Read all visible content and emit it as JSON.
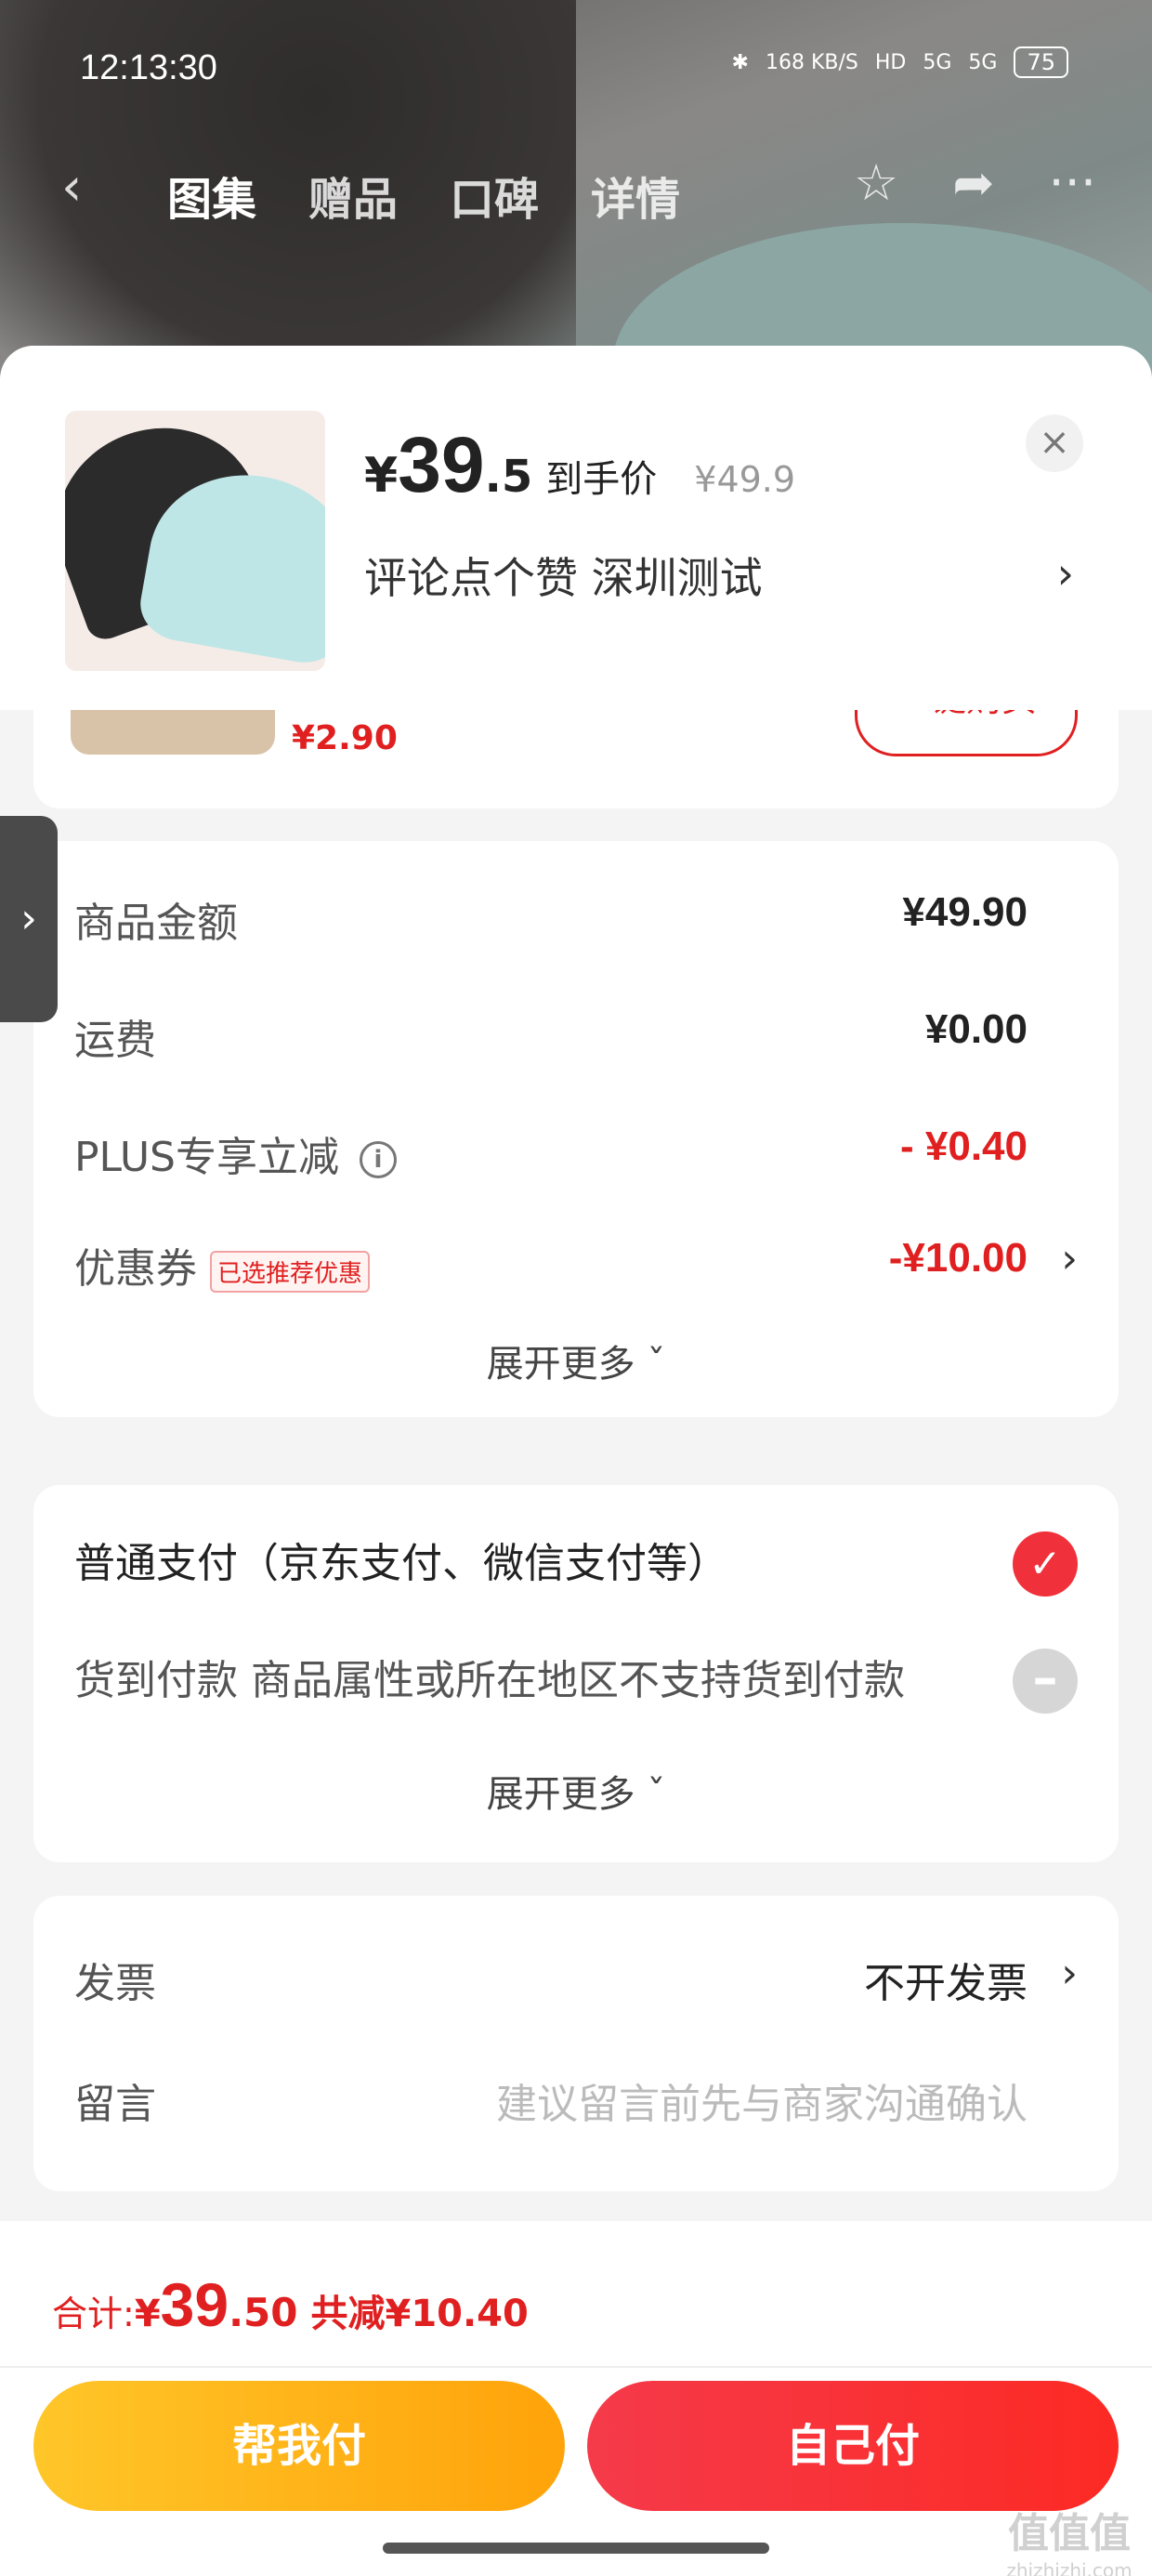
{
  "status_bar": {
    "time": "12:13:30",
    "net_speed": "168 KB/S",
    "hd": "HD",
    "signal1": "5G",
    "signal2": "5G",
    "battery": "75"
  },
  "top_nav": {
    "tabs": [
      "图集",
      "赠品",
      "口碑",
      "详情"
    ],
    "active_tab": "图集"
  },
  "product": {
    "currency": "¥",
    "price_int": "39",
    "price_dec": ".5",
    "price_label": "到手价",
    "original_price": "¥49.9",
    "spec": "评论点个赞  深圳测试"
  },
  "recommended_item": {
    "price": "¥2.90",
    "buy_label": "一键购买"
  },
  "order_summary": {
    "goods_amount_label": "商品金额",
    "goods_amount": "¥49.90",
    "shipping_label": "运费",
    "shipping": "¥0.00",
    "plus_label": "PLUS专享立减",
    "plus_discount": "- ¥0.40",
    "coupon_label": "优惠券",
    "coupon_tag": "已选推荐优惠",
    "coupon_value": "-¥10.00",
    "expand_label": "展开更多"
  },
  "payment": {
    "normal_label": "普通支付（京东支付、微信支付等）",
    "cod_label": "货到付款 商品属性或所在地区不支持货到付款",
    "expand_label": "展开更多"
  },
  "extras": {
    "invoice_label": "发票",
    "invoice_value": "不开发票",
    "message_label": "留言",
    "message_placeholder": "建议留言前先与商家沟通确认"
  },
  "footer": {
    "total_label": "合计:",
    "total_currency": "¥",
    "total_int": "39",
    "total_dec": ".50",
    "reduce_text": "共减¥10.40",
    "help_pay_label": "帮我付",
    "self_pay_label": "自己付"
  },
  "watermark": {
    "text": "值值值",
    "url": "zhizhizhi.com"
  },
  "colors": {
    "accent_red": "#e02020",
    "yellow_button": "#ffb51a",
    "red_button": "#f53a3a"
  }
}
